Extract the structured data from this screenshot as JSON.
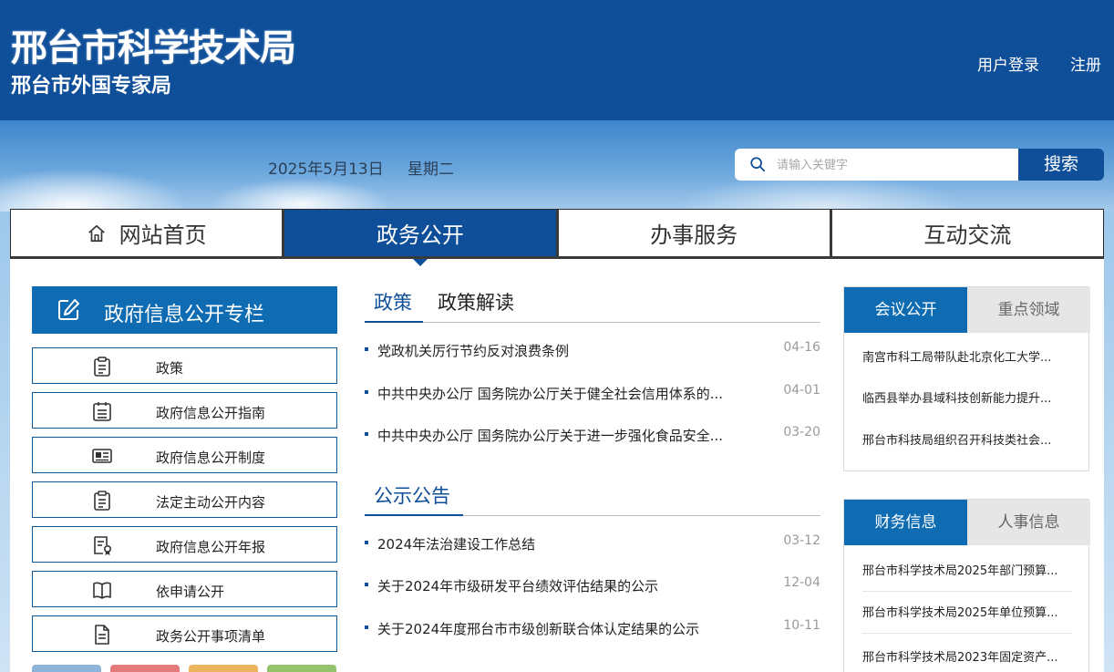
{
  "header": {
    "title": "邢台市科学技术局",
    "subtitle": "邢台市外国专家局",
    "login": "用户登录",
    "register": "注册"
  },
  "topbar": {
    "date": "2025年5月13日",
    "weekday": "星期二",
    "search_placeholder": "请输入关键字",
    "search_button": "搜索"
  },
  "nav": [
    {
      "label": "网站首页",
      "icon": "home-icon",
      "active": false
    },
    {
      "label": "政务公开",
      "active": true
    },
    {
      "label": "办事服务",
      "active": false
    },
    {
      "label": "互动交流",
      "active": false
    }
  ],
  "left": {
    "title": "政府信息公开专栏",
    "items": [
      {
        "label": "政策",
        "icon": "clipboard-icon"
      },
      {
        "label": "政府信息公开指南",
        "icon": "calendar-list-icon"
      },
      {
        "label": "政府信息公开制度",
        "icon": "newspaper-icon"
      },
      {
        "label": "法定主动公开内容",
        "icon": "clipboard-icon"
      },
      {
        "label": "政府信息公开年报",
        "icon": "report-badge-icon"
      },
      {
        "label": "依申请公开",
        "icon": "open-book-icon"
      },
      {
        "label": "政务公开事项清单",
        "icon": "document-icon"
      }
    ],
    "bottom_colors": [
      "#8fb4dc",
      "#e57a7a",
      "#edb45e",
      "#93c46c"
    ]
  },
  "middle": {
    "tabs": [
      {
        "label": "政策",
        "active": true
      },
      {
        "label": "政策解读",
        "active": false
      }
    ],
    "news": [
      {
        "title": "党政机关厉行节约反对浪费条例",
        "date": "04-16"
      },
      {
        "title": "中共中央办公厅 国务院办公厅关于健全社会信用体系的...",
        "date": "04-01"
      },
      {
        "title": "中共中央办公厅 国务院办公厅关于进一步强化食品安全...",
        "date": "03-20"
      }
    ],
    "notice_title": "公示公告",
    "notices": [
      {
        "title": "2024年法治建设工作总结",
        "date": "03-12"
      },
      {
        "title": "关于2024年市级研发平台绩效评估结果的公示",
        "date": "12-04"
      },
      {
        "title": "关于2024年度邢台市市级创新联合体认定结果的公示",
        "date": "10-11"
      }
    ]
  },
  "right": {
    "box1": {
      "tab_on": "会议公开",
      "tab_off": "重点领域",
      "items": [
        "南宫市科工局带队赴北京化工大学...",
        "临西县举办县域科技创新能力提升...",
        "邢台市科技局组织召开科技类社会..."
      ]
    },
    "box2": {
      "tab_on": "财务信息",
      "tab_off": "人事信息",
      "items": [
        "邢台市科学技术局2025年部门预算...",
        "邢台市科学技术局2025年单位预算...",
        "邢台市科学技术局2023年固定资产..."
      ]
    }
  },
  "colors": {
    "brand_blue": "#0f4f9a",
    "accent_blue": "#0f6cb2"
  }
}
